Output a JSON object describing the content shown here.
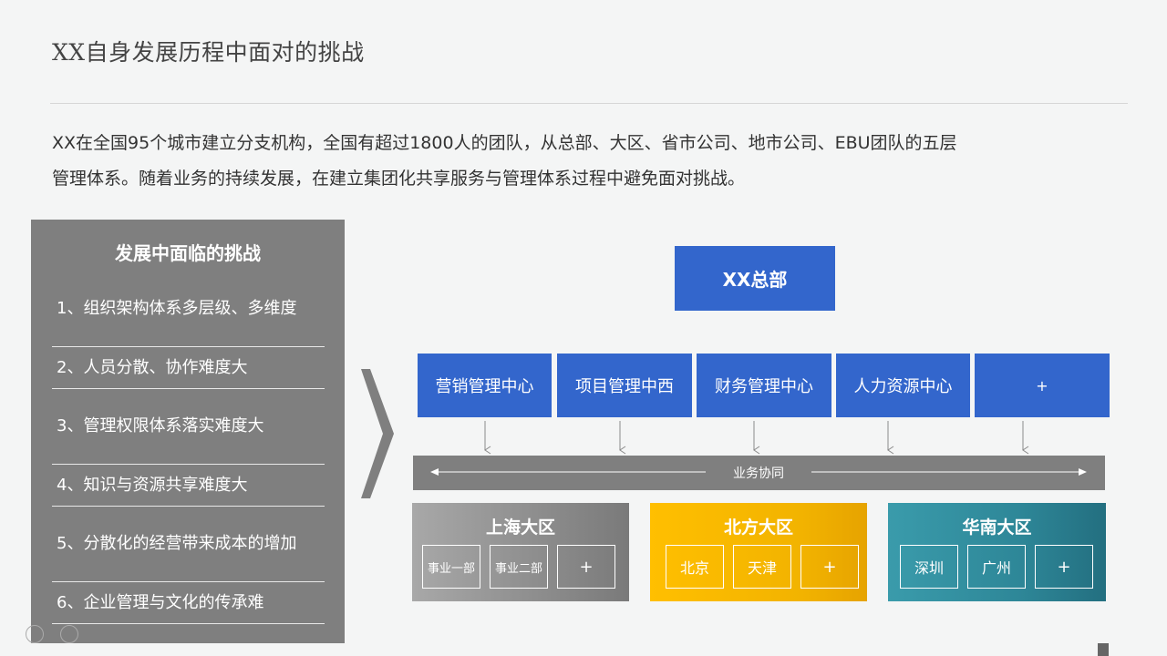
{
  "header": {
    "title": "XX自身发展历程中面对的挑战"
  },
  "intro": {
    "line1": "XX在全国95个城市建立分支机构，全国有超过1800人的团队，从总部、大区、省市公司、地市公司、EBU团队的五层",
    "line2": "管理体系。随着业务的持续发展，在建立集团化共享服务与管理体系过程中避免面对挑战。"
  },
  "challenges": {
    "title": "发展中面临的挑战",
    "items": [
      "1、组织架构体系多层级、多维度",
      "2、人员分散、协作难度大",
      "3、管理权限体系落实难度大",
      "4、知识与资源共享难度大",
      "5、分散化的经营带来成本的增加",
      "6、企业管理与文化的传承难"
    ]
  },
  "org": {
    "hq": "XX总部",
    "centers": [
      "营销管理中心",
      "项目管理中西",
      "财务管理中心",
      "人力资源中心",
      "+"
    ],
    "collab": "业务协同",
    "regions": [
      {
        "name": "上海大区",
        "subs": [
          "事业一部",
          "事业二部",
          "+"
        ]
      },
      {
        "name": "北方大区",
        "subs": [
          "北京",
          "天津",
          "+"
        ]
      },
      {
        "name": "华南大区",
        "subs": [
          "深圳",
          "广州",
          "+"
        ]
      }
    ]
  },
  "colors": {
    "accent_blue": "#3366cc",
    "panel_gray": "#7f7f7f",
    "region_gray": "#8c8c8c",
    "region_yellow": "#f5b400",
    "region_teal": "#2e8fa0"
  }
}
